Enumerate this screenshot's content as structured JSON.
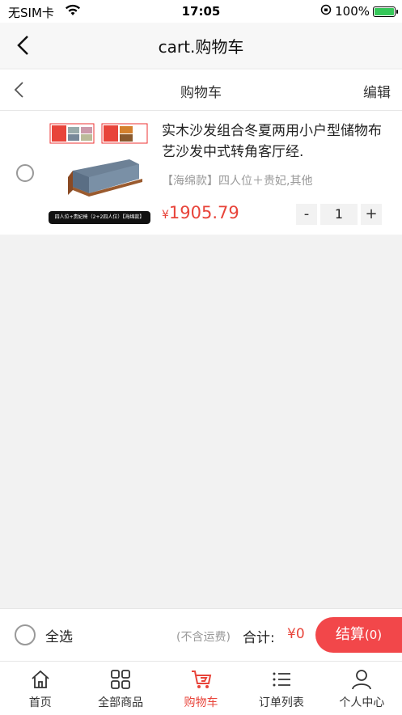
{
  "status_bar": {
    "carrier": "无SIM卡",
    "time": "17:05",
    "battery": "100%"
  },
  "header": {
    "title": "cart.购物车"
  },
  "subheader": {
    "title": "购物车",
    "edit": "编辑"
  },
  "cart_items": [
    {
      "title": "实木沙发组合冬夏两用小户型储物布艺沙发中式转角客厅经.",
      "spec": "【海绵款】四人位＋贵妃,其他",
      "currency": "¥",
      "price": "1905.79",
      "quantity": "1",
      "minus": "-",
      "plus": "+",
      "thumbnail_caption": "四人位+贵妃椅（2+2四人位）【海绵款】"
    }
  ],
  "footer": {
    "select_all": "全选",
    "shipping_note": "(不含运费)",
    "total_label": "合计:",
    "total_value": "¥0",
    "checkout_label": "结算",
    "checkout_count": "(0)"
  },
  "tabs": [
    {
      "label": "首页",
      "icon": "home-icon",
      "active": false
    },
    {
      "label": "全部商品",
      "icon": "grid-icon",
      "active": false
    },
    {
      "label": "购物车",
      "icon": "cart-icon",
      "active": true
    },
    {
      "label": "订单列表",
      "icon": "list-icon",
      "active": false
    },
    {
      "label": "个人中心",
      "icon": "person-icon",
      "active": false
    }
  ],
  "colors": {
    "accent": "#e8443a",
    "checkout_bg": "#f2474a",
    "battery": "#35c759"
  }
}
